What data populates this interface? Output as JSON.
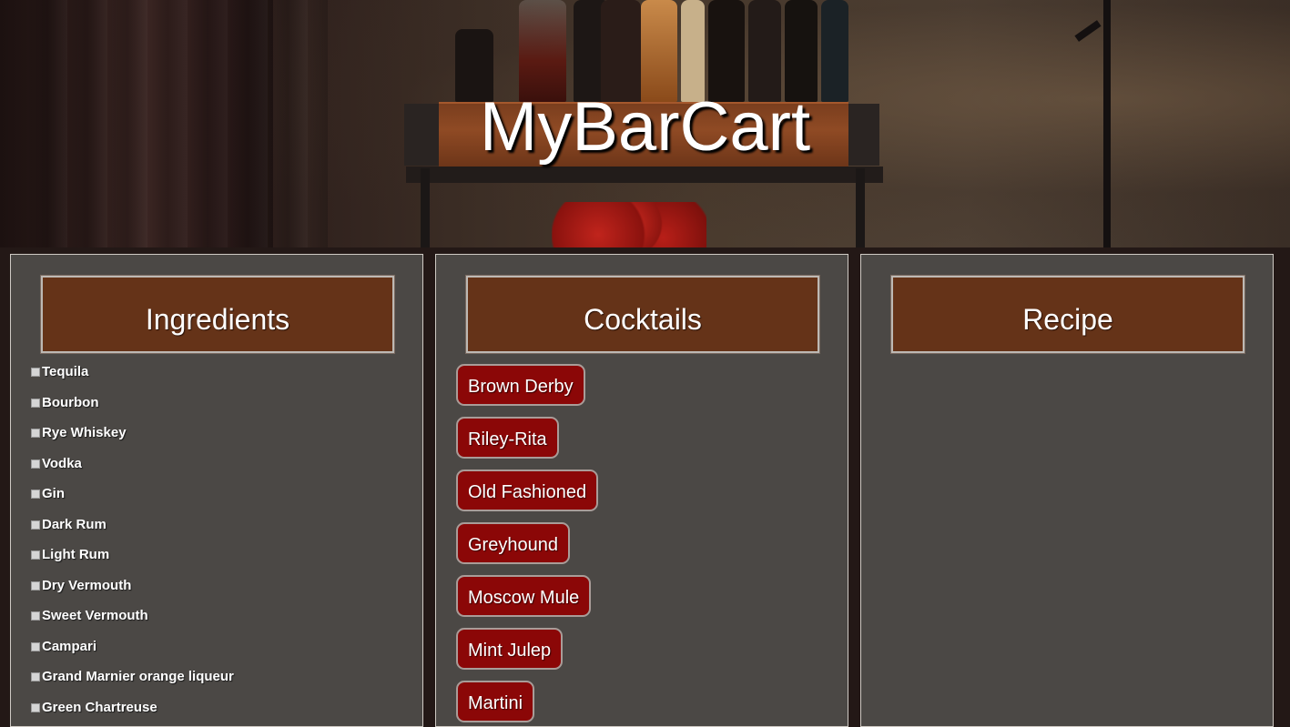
{
  "header": {
    "title": "MyBarCart"
  },
  "panels": {
    "ingredients": {
      "title": "Ingredients"
    },
    "cocktails": {
      "title": "Cocktails"
    },
    "recipe": {
      "title": "Recipe"
    }
  },
  "ingredients": [
    "Tequila",
    "Bourbon",
    "Rye Whiskey",
    "Vodka",
    "Gin",
    "Dark Rum",
    "Light Rum",
    "Dry Vermouth",
    "Sweet Vermouth",
    "Campari",
    "Grand Marnier orange liqueur",
    "Green Chartreuse"
  ],
  "cocktails": [
    "Brown Derby",
    "Riley-Rita",
    "Old Fashioned",
    "Greyhound",
    "Moscow Mule",
    "Mint Julep",
    "Martini"
  ],
  "colors": {
    "panel_bg": "#4b4845",
    "header_bg": "#653318",
    "cocktail_button": "#8b0707",
    "page_bg": "#231816"
  }
}
